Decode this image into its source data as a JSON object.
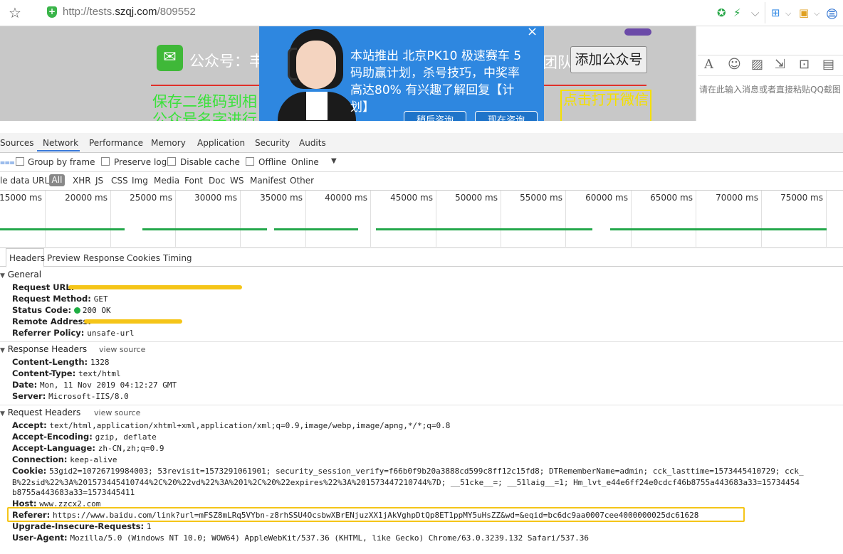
{
  "browser": {
    "url_prefix": "http://tests.",
    "url_domain": "szqj.com",
    "url_path": "/809552",
    "url_cursor": "/"
  },
  "page": {
    "gzh_label": "公众号：",
    "gzh_partial": "丰",
    "team_label": "团队",
    "add_button": "添加公众号",
    "green_line1": "保存二维码到相",
    "green_line2": "公众号名字进行",
    "ad_text": "点击打开微信",
    "popup": {
      "text": "本站推出 北京PK10 极速赛车 5码助赢计划，杀号技巧，中奖率高达80%   有兴趣了解回复【计划】",
      "btn1": "稍后咨询",
      "btn2": "现在咨询",
      "close": "×"
    },
    "chat_placeholder": "请在此输入消息或者直接粘贴QQ截图"
  },
  "devtools": {
    "tabs": [
      "Sources",
      "Network",
      "Performance",
      "Memory",
      "Application",
      "Security",
      "Audits"
    ],
    "active_tab": "Network",
    "controls": {
      "group_by_frame": "Group by frame",
      "preserve_log": "Preserve log",
      "disable_cache": "Disable cache",
      "offline": "Offline",
      "throttle": "Online"
    },
    "filters": [
      "le data URLs",
      "All",
      "XHR",
      "JS",
      "CSS",
      "Img",
      "Media",
      "Font",
      "Doc",
      "WS",
      "Manifest",
      "Other"
    ],
    "timeline_ticks": [
      "15000 ms",
      "20000 ms",
      "25000 ms",
      "30000 ms",
      "35000 ms",
      "40000 ms",
      "45000 ms",
      "50000 ms",
      "55000 ms",
      "60000 ms",
      "65000 ms",
      "70000 ms",
      "75000 ms"
    ],
    "sub_tabs": [
      "Headers",
      "Preview",
      "Response",
      "Cookies",
      "Timing"
    ],
    "general": {
      "title": "General",
      "request_url_label": "Request URL:",
      "request_method_label": "Request Method:",
      "request_method": "GET",
      "status_code_label": "Status Code:",
      "status_code": "200 OK",
      "remote_address_label": "Remote Address:",
      "referrer_policy_label": "Referrer Policy:",
      "referrer_policy": "unsafe-url"
    },
    "response_headers": {
      "title": "Response Headers",
      "view_source": "view source",
      "items": [
        {
          "k": "Content-Length:",
          "v": "1328"
        },
        {
          "k": "Content-Type:",
          "v": "text/html"
        },
        {
          "k": "Date:",
          "v": "Mon, 11 Nov 2019 04:12:27 GMT"
        },
        {
          "k": "Server:",
          "v": "Microsoft-IIS/8.0"
        }
      ]
    },
    "request_headers": {
      "title": "Request Headers",
      "view_source": "view source",
      "accept_k": "Accept:",
      "accept_v": "text/html,application/xhtml+xml,application/xml;q=0.9,image/webp,image/apng,*/*;q=0.8",
      "encoding_k": "Accept-Encoding:",
      "encoding_v": "gzip, deflate",
      "language_k": "Accept-Language:",
      "language_v": "zh-CN,zh;q=0.9",
      "connection_k": "Connection:",
      "connection_v": "keep-alive",
      "cookie_k": "Cookie:",
      "cookie_v1": "53gid2=10726719984003; 53revisit=1573291061901; security_session_verify=f66b0f9b20a3888cd599c8ff12c15fd8; DTRememberName=admin; cck_lasttime=1573445410729; cck_",
      "cookie_v2": "B%22sid%22%3A%201573445410744%2C%20%22vd%22%3A%201%2C%20%22expires%22%3A%201573447210744%7D; __51cke__=; __51laig__=1; Hm_lvt_e44e6ff24e0cdcf46b8755a443683a33=15734454",
      "cookie_v3": "b8755a443683a33=1573445411",
      "host_k": "Host:",
      "host_v": "www.zzcx2.com",
      "referer_k": "Referer:",
      "referer_v": "https://www.baidu.com/link?url=mFSZ8mLRq5VYbn-z8rhSSU4OcsbwXBrENjuzXX1jAkVghpDtQp8ET1ppMY5uHsZZ&wd=&eqid=bc6dc9aa0007cee4000000025dc61628",
      "upgrade_k": "Upgrade-Insecure-Requests:",
      "upgrade_v": "1",
      "ua_k": "User-Agent:",
      "ua_v": "Mozilla/5.0 (Windows NT 10.0; WOW64) AppleWebKit/537.36 (KHTML, like Gecko) Chrome/63.0.3239.132 Safari/537.36"
    }
  }
}
